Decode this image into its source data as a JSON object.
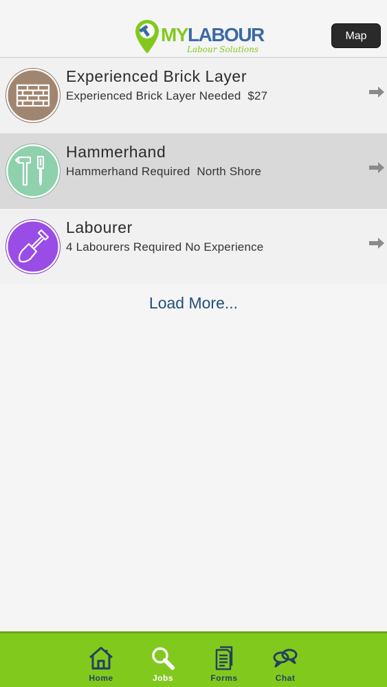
{
  "header": {
    "logo_my": "MY",
    "logo_labour": "LABOUR",
    "logo_tagline": "Labour Solutions",
    "map_label": "Map"
  },
  "jobs": [
    {
      "title": "Experienced Brick Layer",
      "subtitle": "Experienced Brick Layer Needed  $27",
      "icon": "brick-wall-icon",
      "icon_color": "#a08671"
    },
    {
      "title": "Hammerhand",
      "subtitle": "Hammerhand Required  North Shore",
      "icon": "hammer-screwdriver-icon",
      "icon_color": "#8fd0ad"
    },
    {
      "title": "Labourer",
      "subtitle": "4 Labourers Required No Experience",
      "icon": "shovel-icon",
      "icon_color": "#9a4ce6"
    }
  ],
  "load_more": "Load More...",
  "nav": [
    {
      "label": "Home",
      "icon": "home-icon",
      "active": false
    },
    {
      "label": "Jobs",
      "icon": "search-icon",
      "active": true
    },
    {
      "label": "Forms",
      "icon": "document-icon",
      "active": false
    },
    {
      "label": "Chat",
      "icon": "chat-icon",
      "active": false
    }
  ],
  "colors": {
    "brand_green": "#82c91e",
    "brand_blue": "#3b6aa5",
    "nav_icon": "#24405e"
  }
}
